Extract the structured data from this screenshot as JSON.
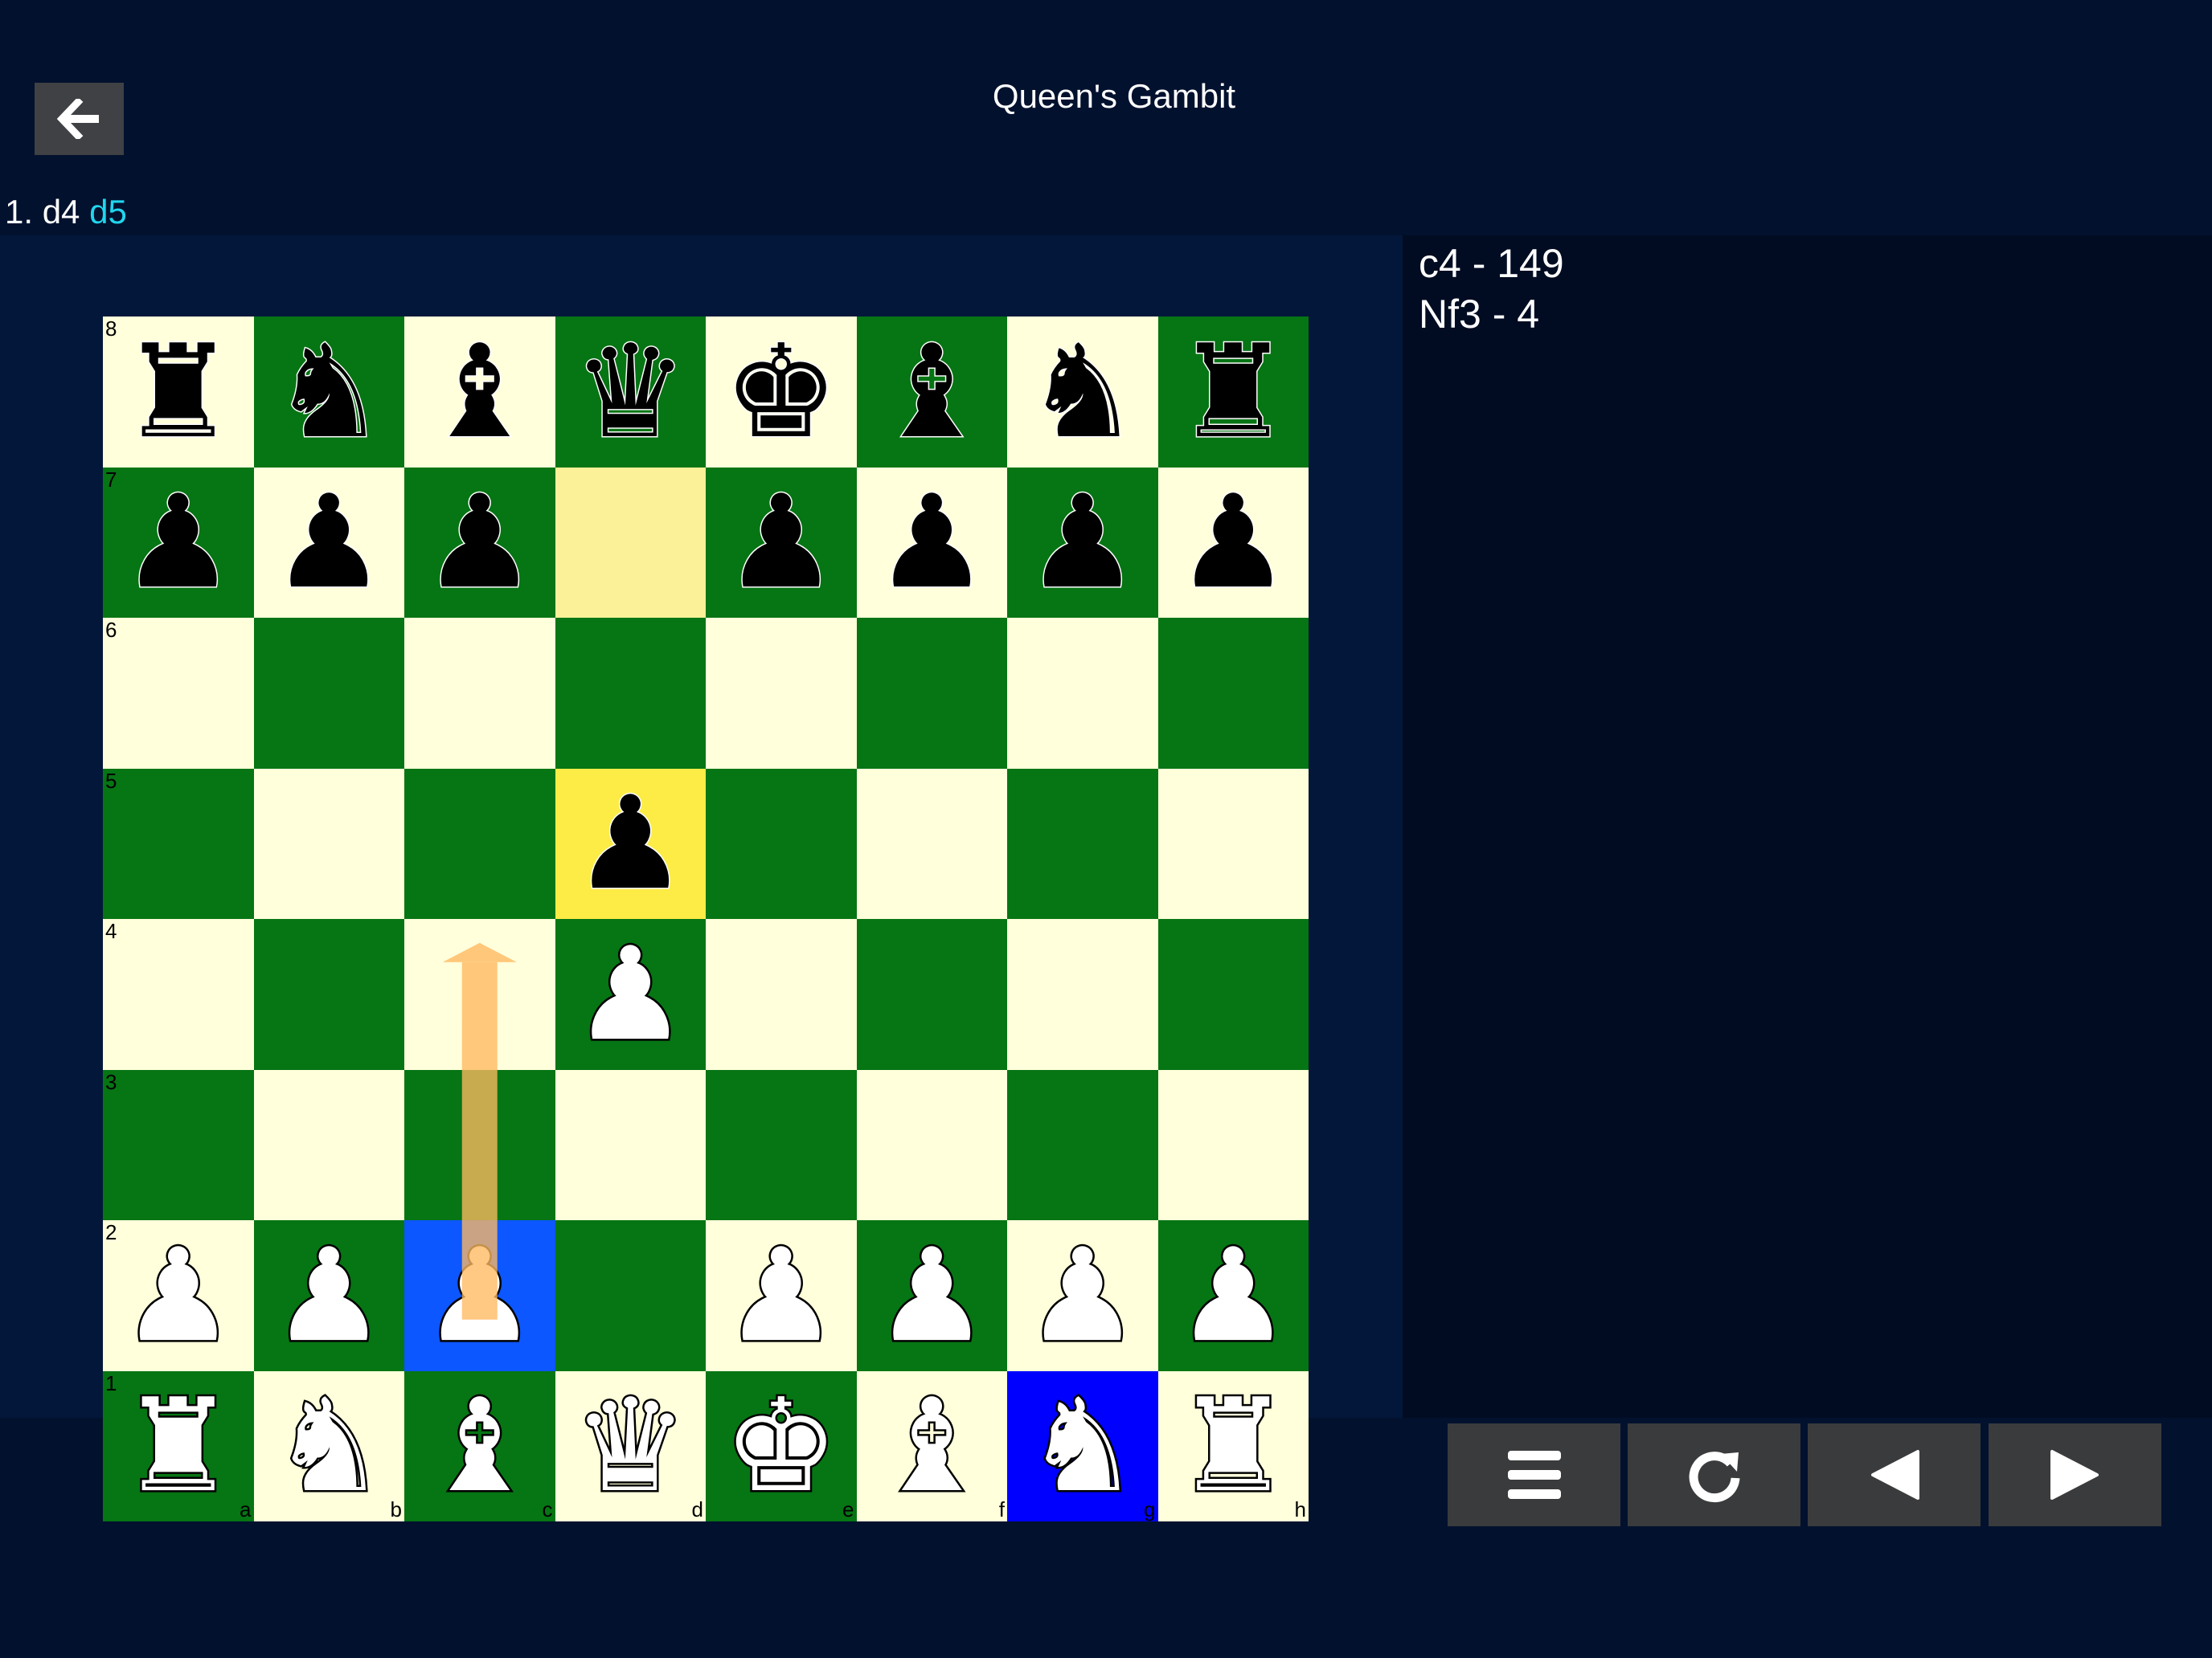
{
  "header": {
    "title": "Queen's Gambit",
    "back_icon": "arrow-left-icon"
  },
  "moves": [
    {
      "text": "1.",
      "current": false
    },
    {
      "text": "d4",
      "current": false
    },
    {
      "text": "d5",
      "current": true
    }
  ],
  "suggestions": [
    {
      "label": "c4 - 149"
    },
    {
      "label": "Nf3 - 4"
    }
  ],
  "board": {
    "files": [
      "a",
      "b",
      "c",
      "d",
      "e",
      "f",
      "h",
      "h"
    ],
    "file_labels": [
      "a",
      "b",
      "c",
      "d",
      "e",
      "f",
      "g",
      "h"
    ],
    "ranks": [
      "8",
      "7",
      "6",
      "5",
      "4",
      "3",
      "2",
      "1"
    ],
    "rows": [
      [
        "r",
        "n",
        "b",
        "q",
        "k",
        "b",
        "n",
        "r"
      ],
      [
        "p",
        "p",
        "p",
        "",
        "p",
        "p",
        "p",
        "p"
      ],
      [
        "",
        "",
        "",
        "",
        "",
        "",
        "",
        ""
      ],
      [
        "",
        "",
        "",
        "p",
        "",
        "",
        "",
        ""
      ],
      [
        "",
        "",
        "",
        "P",
        "",
        "",
        "",
        ""
      ],
      [
        "",
        "",
        "",
        "",
        "",
        "",
        "",
        ""
      ],
      [
        "P",
        "P",
        "P",
        "",
        "P",
        "P",
        "P",
        "P"
      ],
      [
        "R",
        "N",
        "B",
        "Q",
        "K",
        "B",
        "N",
        "R"
      ]
    ],
    "last_move_from": "d7",
    "last_move_to": "d5",
    "selected": [
      "c2",
      "g1"
    ],
    "suggested_arrow": {
      "from": "c2",
      "to": "c4"
    },
    "colors": {
      "light": "#ffffdb",
      "dark": "#067514",
      "arrow": "#ffb860"
    }
  },
  "controls": [
    {
      "name": "menu-button",
      "icon": "menu-icon"
    },
    {
      "name": "reset-button",
      "icon": "refresh-icon"
    },
    {
      "name": "previous-move-button",
      "icon": "triangle-left-icon"
    },
    {
      "name": "next-move-button",
      "icon": "triangle-right-icon"
    }
  ]
}
